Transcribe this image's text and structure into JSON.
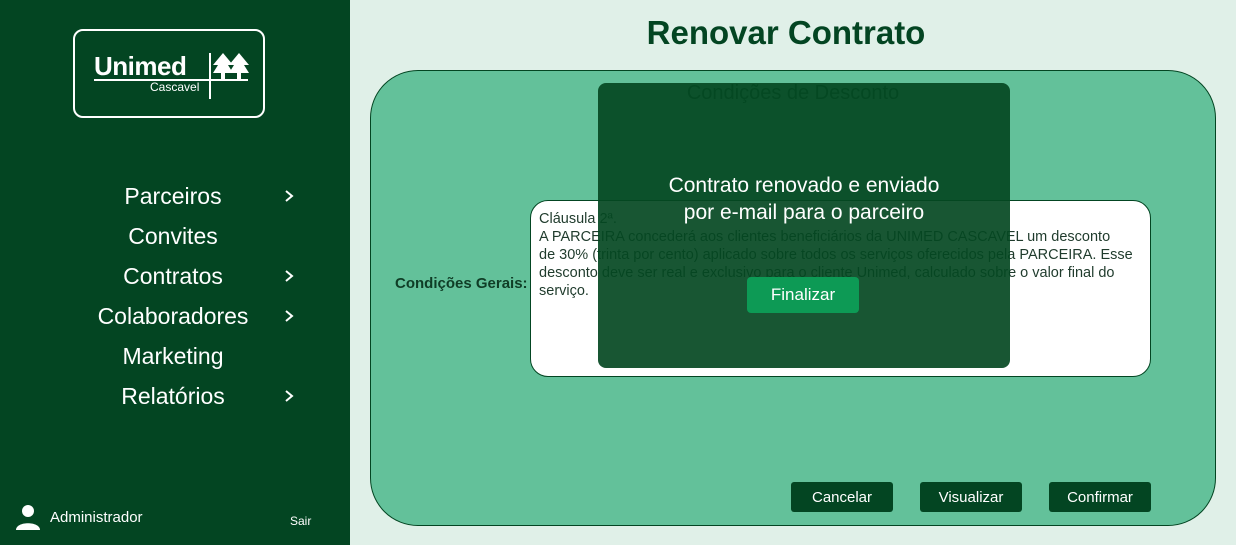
{
  "brand": {
    "name": "Unimed",
    "city": "Cascavel"
  },
  "sidebar": {
    "items": [
      {
        "label": "Parceiros",
        "has_submenu": true
      },
      {
        "label": "Convites",
        "has_submenu": false
      },
      {
        "label": "Contratos",
        "has_submenu": true
      },
      {
        "label": "Colaboradores",
        "has_submenu": true
      },
      {
        "label": "Marketing",
        "has_submenu": false
      },
      {
        "label": "Relatórios",
        "has_submenu": true
      }
    ],
    "user": {
      "name": "Administrador",
      "icon": "user-icon"
    },
    "logout_label": "Sair"
  },
  "main": {
    "title": "Renovar Contrato",
    "section_title": "Condições de Desconto",
    "field_label": "Condições Gerais:",
    "terms": {
      "line1": "Cláusula 2ª.",
      "line2": "A PARCEIRA concederá aos clientes beneficiários da UNIMED CASCAVEL um desconto",
      "line3": "de 30% (trinta por cento) aplicado sobre todos os serviços oferecidos pela PARCEIRA. Esse",
      "line4": "desconto deve ser real e exclusivo para o cliente Unimed, calculado sobre o valor final do",
      "line5": "serviço."
    },
    "buttons": {
      "cancel": "Cancelar",
      "view": "Visualizar",
      "confirm": "Confirmar"
    }
  },
  "modal": {
    "message_line1": "Contrato renovado e enviado",
    "message_line2": "por e-mail para o parceiro",
    "button": "Finalizar"
  },
  "colors": {
    "sidebar": "#034522",
    "background": "#e0f0e8",
    "panel": "#63c19a",
    "modal": "#044822",
    "modal_button": "#0d9a55"
  }
}
